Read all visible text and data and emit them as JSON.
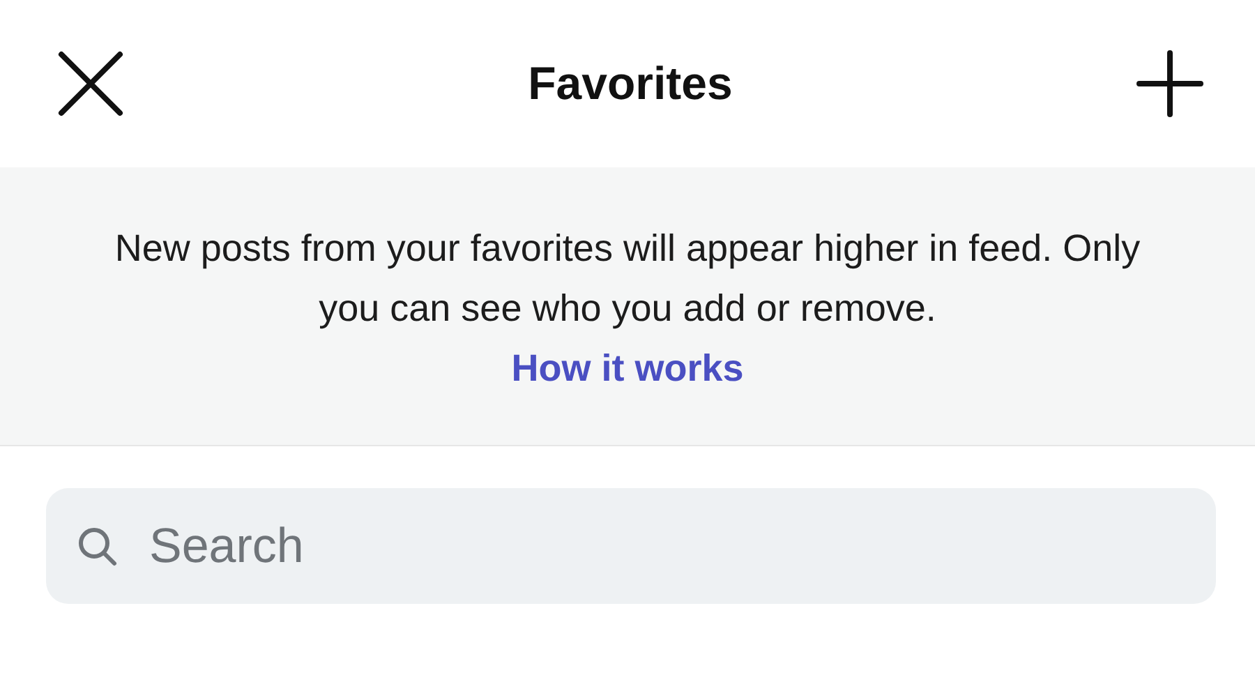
{
  "header": {
    "title": "Favorites"
  },
  "banner": {
    "text": "New posts from your favorites will appear higher in feed. Only you can see who you add or remove.",
    "link": "How it works"
  },
  "search": {
    "placeholder": "Search"
  }
}
